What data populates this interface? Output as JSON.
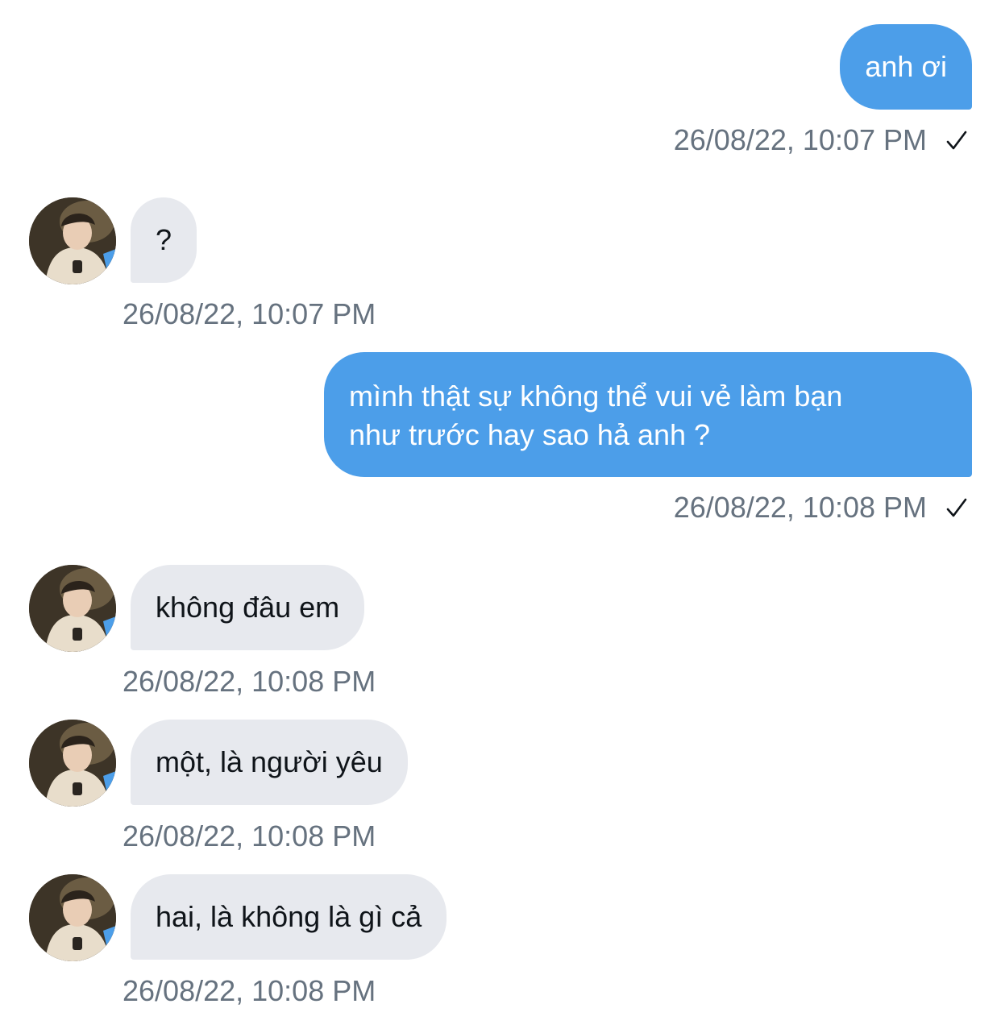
{
  "messages": [
    {
      "text": "anh ơi",
      "timestamp": "26/08/22, 10:07 PM",
      "status": "sent"
    },
    {
      "text": "?",
      "timestamp": "26/08/22, 10:07 PM"
    },
    {
      "text_line1": "mình thật sự không thể vui vẻ làm bạn",
      "text_line2": "như trước hay sao hả anh ?",
      "timestamp": "26/08/22, 10:08 PM",
      "status": "sent"
    },
    {
      "text": "không đâu em",
      "timestamp": "26/08/22, 10:08 PM"
    },
    {
      "text": "một, là người yêu",
      "timestamp": "26/08/22, 10:08 PM"
    },
    {
      "text": "hai, là không là gì cả",
      "timestamp": "26/08/22, 10:08 PM"
    }
  ],
  "icons": {
    "sent_status": "checkmark-icon",
    "avatar": "profile-avatar"
  },
  "colors": {
    "sent_bubble": "#4c9ee9",
    "received_bubble": "#e7e9ee",
    "timestamp": "#66727f"
  }
}
